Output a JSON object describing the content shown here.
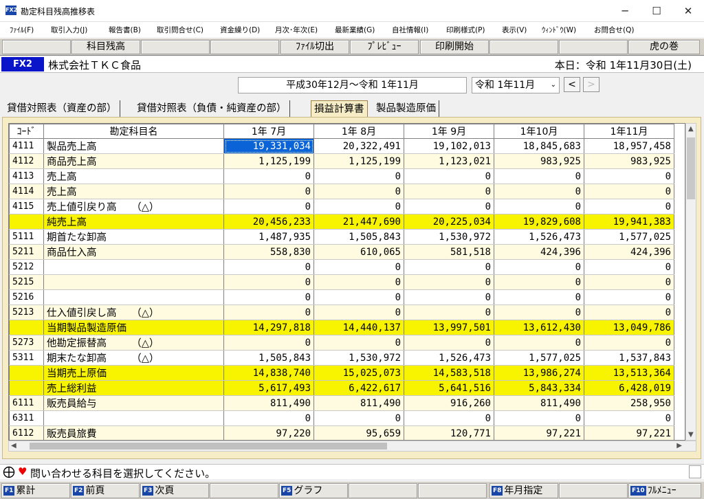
{
  "window": {
    "icon": "FX2",
    "title": "勘定科目残高推移表",
    "minimize": "─",
    "maximize": "☐",
    "close": "✕"
  },
  "menu": [
    "ﾌｧｲﾙ(F)",
    "取引入力(J)",
    "報告書(B)",
    "取引問合せ(C)",
    "資金繰り(D)",
    "月次･年次(E)",
    "最新業績(G)",
    "自社情報(I)",
    "印刷様式(P)",
    "表示(V)",
    "ｳｨﾝﾄﾞｳ(W)",
    "お問合せ(Q)"
  ],
  "toolbar": {
    "kamoku": "科目残高",
    "kirikae": "ﾌｧｲﾙ切出",
    "preview": "ﾌﾟﾚﾋﾞｭｰ",
    "print": "印刷開始",
    "tora": "虎の巻"
  },
  "info": {
    "badge": "FX2",
    "company": "株式会社ＴＫＣ食品",
    "today": "本日：令和 1年11月30日(土)"
  },
  "period": {
    "range": "平成30年12月～令和 1年11月",
    "selected": "令和 1年11月",
    "prev": "<",
    "next": ">"
  },
  "tabs": [
    "貸借対照表（資産の部）",
    "貸借対照表（負債・純資産の部）",
    "損益計算書",
    "製品製造原価"
  ],
  "table": {
    "headers": [
      "ｺｰﾄﾞ",
      "勘定科目名",
      "1年 7月",
      "1年 8月",
      "1年 9月",
      "1年10月",
      "1年11月"
    ],
    "rows": [
      {
        "code": "4111",
        "name": "製品売上高",
        "v": [
          "19,331,034",
          "20,322,491",
          "19,102,013",
          "18,845,683",
          "18,957,458"
        ],
        "kind": "odd"
      },
      {
        "code": "4112",
        "name": "商品売上高",
        "v": [
          "1,125,199",
          "1,125,199",
          "1,123,021",
          "983,925",
          "983,925"
        ],
        "kind": "even"
      },
      {
        "code": "4113",
        "name": "売上高",
        "v": [
          "0",
          "0",
          "0",
          "0",
          "0"
        ],
        "kind": "odd"
      },
      {
        "code": "4114",
        "name": "売上高",
        "v": [
          "0",
          "0",
          "0",
          "0",
          "0"
        ],
        "kind": "even"
      },
      {
        "code": "4115",
        "name": "売上値引戻り高　　（△）",
        "v": [
          "0",
          "0",
          "0",
          "0",
          "0"
        ],
        "kind": "odd"
      },
      {
        "code": "",
        "name": "純売上高",
        "v": [
          "20,456,233",
          "21,447,690",
          "20,225,034",
          "19,829,608",
          "19,941,383"
        ],
        "kind": "total"
      },
      {
        "code": "5111",
        "name": "期首たな卸高",
        "v": [
          "1,487,935",
          "1,505,843",
          "1,530,972",
          "1,526,473",
          "1,577,025"
        ],
        "kind": "odd"
      },
      {
        "code": "5211",
        "name": "商品仕入高",
        "v": [
          "558,830",
          "610,065",
          "581,518",
          "424,396",
          "424,396"
        ],
        "kind": "even"
      },
      {
        "code": "5212",
        "name": "",
        "v": [
          "0",
          "0",
          "0",
          "0",
          "0"
        ],
        "kind": "odd"
      },
      {
        "code": "5215",
        "name": "",
        "v": [
          "0",
          "0",
          "0",
          "0",
          "0"
        ],
        "kind": "even"
      },
      {
        "code": "5216",
        "name": "",
        "v": [
          "0",
          "0",
          "0",
          "0",
          "0"
        ],
        "kind": "odd"
      },
      {
        "code": "5213",
        "name": "仕入値引戻し高　　（△）",
        "v": [
          "0",
          "0",
          "0",
          "0",
          "0"
        ],
        "kind": "even"
      },
      {
        "code": "",
        "name": "当期製品製造原価",
        "v": [
          "14,297,818",
          "14,440,137",
          "13,997,501",
          "13,612,430",
          "13,049,786"
        ],
        "kind": "total"
      },
      {
        "code": "5273",
        "name": "他勘定振替高　　　（△）",
        "v": [
          "0",
          "0",
          "0",
          "0",
          "0"
        ],
        "kind": "even"
      },
      {
        "code": "5311",
        "name": "期末たな卸高　　　（△）",
        "v": [
          "1,505,843",
          "1,530,972",
          "1,526,473",
          "1,577,025",
          "1,537,843"
        ],
        "kind": "odd"
      },
      {
        "code": "",
        "name": "当期売上原価",
        "v": [
          "14,838,740",
          "15,025,073",
          "14,583,518",
          "13,986,274",
          "13,513,364"
        ],
        "kind": "total"
      },
      {
        "code": "",
        "name": "売上総利益",
        "v": [
          "5,617,493",
          "6,422,617",
          "5,641,516",
          "5,843,334",
          "6,428,019"
        ],
        "kind": "total"
      },
      {
        "code": "6111",
        "name": "販売員給与",
        "v": [
          "811,490",
          "811,490",
          "916,260",
          "811,490",
          "258,950"
        ],
        "kind": "even"
      },
      {
        "code": "6311",
        "name": "",
        "v": [
          "0",
          "0",
          "0",
          "0",
          "0"
        ],
        "kind": "odd"
      },
      {
        "code": "6112",
        "name": "販売員旅費",
        "v": [
          "97,220",
          "95,659",
          "120,771",
          "97,221",
          "97,221"
        ],
        "kind": "even"
      }
    ]
  },
  "status": {
    "message": "問い合わせる科目を選択してください。"
  },
  "fkeys": [
    {
      "key": "F1",
      "label": "累計"
    },
    {
      "key": "F2",
      "label": "前頁"
    },
    {
      "key": "F3",
      "label": "次頁"
    },
    {
      "key": "F5",
      "label": "グラフ"
    },
    {
      "key": "F8",
      "label": "年月指定"
    },
    {
      "key": "F10",
      "label": "ﾌﾙﾒﾆｭｰ"
    }
  ]
}
